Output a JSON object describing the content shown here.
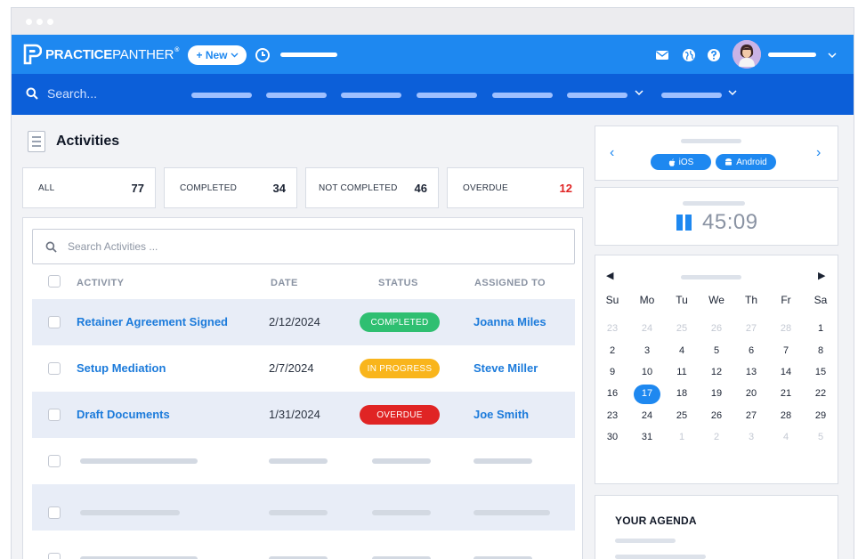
{
  "header": {
    "brand_bold": "PRACTICE",
    "brand_thin": "PANTHER",
    "brand_reg": "®",
    "new_button": "+ New"
  },
  "subnav": {
    "search_placeholder": "Search..."
  },
  "activities": {
    "title": "Activities",
    "stats": [
      {
        "label": "ALL",
        "value": "77"
      },
      {
        "label": "COMPLETED",
        "value": "34"
      },
      {
        "label": "NOT COMPLETED",
        "value": "46"
      },
      {
        "label": "OVERDUE",
        "value": "12"
      }
    ],
    "search_placeholder": "Search Activities ...",
    "columns": [
      "ACTIVITY",
      "DATE",
      "STATUS",
      "ASSIGNED TO"
    ],
    "rows": [
      {
        "activity": "Retainer Agreement Signed",
        "date": "2/12/2024",
        "status": "COMPLETED",
        "assigned": "Joanna Miles"
      },
      {
        "activity": "Setup Mediation",
        "date": "2/7/2024",
        "status": "IN PROGRESS",
        "assigned": "Steve Miller"
      },
      {
        "activity": "Draft Documents",
        "date": "1/31/2024",
        "status": "OVERDUE",
        "assigned": "Joe Smith"
      }
    ],
    "colors": {
      "completed": "#2fbf71",
      "in_progress": "#f9b51c",
      "overdue": "#e02424",
      "link": "#1c7bdb"
    }
  },
  "apps": {
    "ios_label": "iOS",
    "android_label": "Android"
  },
  "timer": {
    "value": "45:09"
  },
  "calendar": {
    "weekdays": [
      "Su",
      "Mo",
      "Tu",
      "We",
      "Th",
      "Fr",
      "Sa"
    ],
    "weeks": [
      [
        "23",
        "24",
        "25",
        "26",
        "27",
        "28",
        "1"
      ],
      [
        "2",
        "3",
        "4",
        "5",
        "6",
        "7",
        "8"
      ],
      [
        "9",
        "10",
        "11",
        "12",
        "13",
        "14",
        "15"
      ],
      [
        "16",
        "17",
        "18",
        "19",
        "20",
        "21",
        "22"
      ],
      [
        "23",
        "24",
        "25",
        "26",
        "27",
        "28",
        "29"
      ],
      [
        "30",
        "31",
        "1",
        "2",
        "3",
        "4",
        "5"
      ]
    ],
    "today": "17"
  },
  "agenda": {
    "title": "YOUR AGENDA"
  },
  "theme": {
    "primary": "#1e88f0",
    "nav_dark": "#0c5fd9"
  }
}
